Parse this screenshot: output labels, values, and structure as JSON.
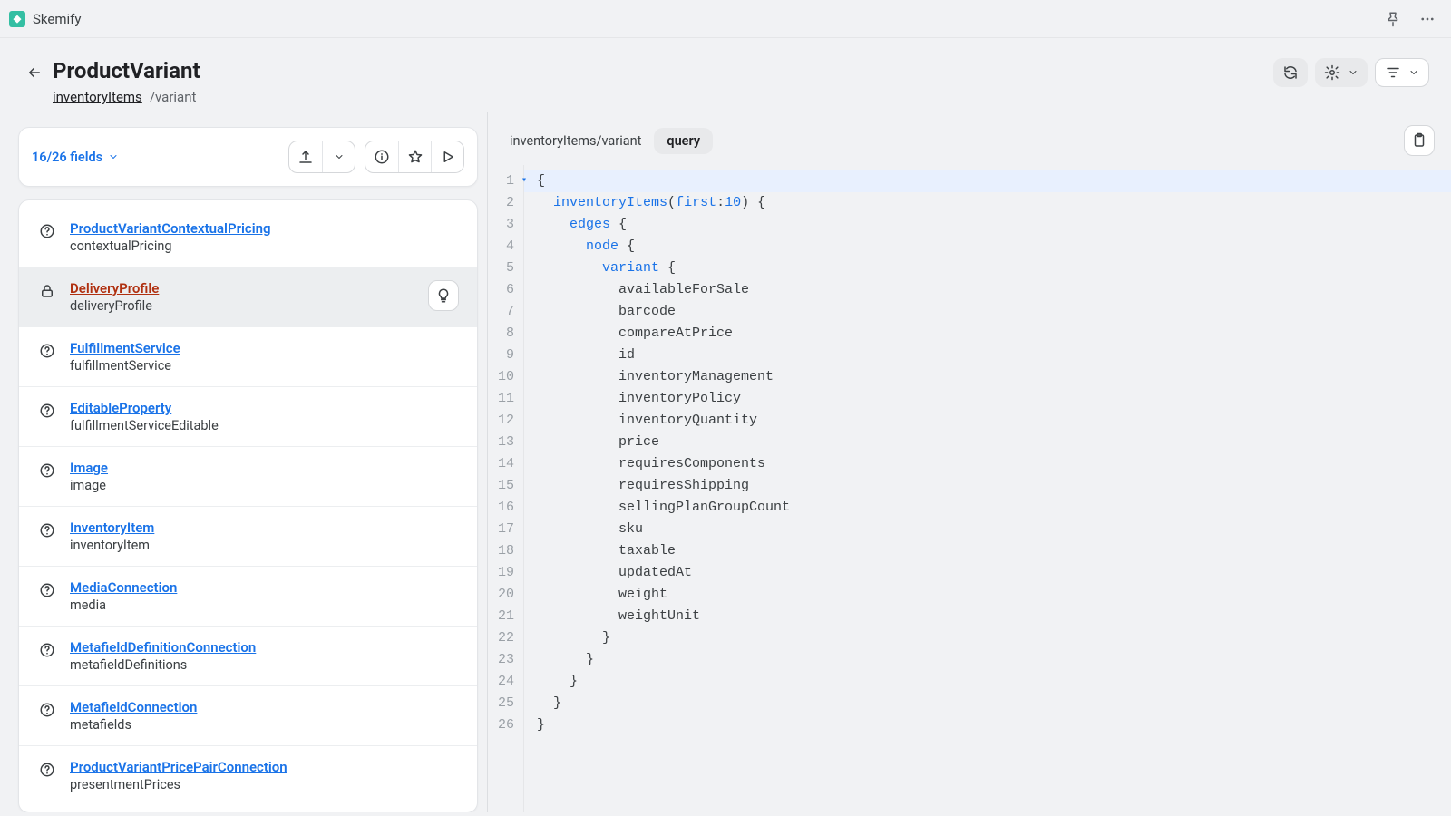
{
  "app": {
    "name": "Skemify"
  },
  "header": {
    "title": "ProductVariant",
    "breadcrumb_link": "inventoryItems",
    "breadcrumb_tail": "/variant"
  },
  "controls": {
    "counter": "16/26 fields"
  },
  "fields": [
    {
      "type": "ProductVariantContextualPricing",
      "name": "contextualPricing",
      "icon": "help",
      "selected": false
    },
    {
      "type": "DeliveryProfile",
      "name": "deliveryProfile",
      "icon": "lock",
      "selected": true
    },
    {
      "type": "FulfillmentService",
      "name": "fulfillmentService",
      "icon": "help",
      "selected": false
    },
    {
      "type": "EditableProperty",
      "name": "fulfillmentServiceEditable",
      "icon": "help",
      "selected": false
    },
    {
      "type": "Image",
      "name": "image",
      "icon": "help",
      "selected": false
    },
    {
      "type": "InventoryItem",
      "name": "inventoryItem",
      "icon": "help",
      "selected": false
    },
    {
      "type": "MediaConnection",
      "name": "media",
      "icon": "help",
      "selected": false
    },
    {
      "type": "MetafieldDefinitionConnection",
      "name": "metafieldDefinitions",
      "icon": "help",
      "selected": false
    },
    {
      "type": "MetafieldConnection",
      "name": "metafields",
      "icon": "help",
      "selected": false
    },
    {
      "type": "ProductVariantPricePairConnection",
      "name": "presentmentPrices",
      "icon": "help",
      "selected": false
    }
  ],
  "code": {
    "path": "inventoryItems/variant",
    "tab": "query",
    "lines": [
      {
        "n": 1,
        "fold": true,
        "tokens": [
          [
            "brace",
            "{"
          ]
        ]
      },
      {
        "n": 2,
        "tokens": [
          [
            "text",
            "  "
          ],
          [
            "name",
            "inventoryItems"
          ],
          [
            "text",
            "("
          ],
          [
            "name",
            "first"
          ],
          [
            "text",
            ":"
          ],
          [
            "num",
            "10"
          ],
          [
            "text",
            ") "
          ],
          [
            "brace",
            "{"
          ]
        ]
      },
      {
        "n": 3,
        "tokens": [
          [
            "text",
            "    "
          ],
          [
            "name",
            "edges"
          ],
          [
            "text",
            " "
          ],
          [
            "brace",
            "{"
          ]
        ]
      },
      {
        "n": 4,
        "tokens": [
          [
            "text",
            "      "
          ],
          [
            "name",
            "node"
          ],
          [
            "text",
            " "
          ],
          [
            "brace",
            "{"
          ]
        ]
      },
      {
        "n": 5,
        "tokens": [
          [
            "text",
            "        "
          ],
          [
            "name",
            "variant"
          ],
          [
            "text",
            " "
          ],
          [
            "brace",
            "{"
          ]
        ]
      },
      {
        "n": 6,
        "tokens": [
          [
            "text",
            "          "
          ],
          [
            "field",
            "availableForSale"
          ]
        ]
      },
      {
        "n": 7,
        "tokens": [
          [
            "text",
            "          "
          ],
          [
            "field",
            "barcode"
          ]
        ]
      },
      {
        "n": 8,
        "tokens": [
          [
            "text",
            "          "
          ],
          [
            "field",
            "compareAtPrice"
          ]
        ]
      },
      {
        "n": 9,
        "tokens": [
          [
            "text",
            "          "
          ],
          [
            "field",
            "id"
          ]
        ]
      },
      {
        "n": 10,
        "tokens": [
          [
            "text",
            "          "
          ],
          [
            "field",
            "inventoryManagement"
          ]
        ]
      },
      {
        "n": 11,
        "tokens": [
          [
            "text",
            "          "
          ],
          [
            "field",
            "inventoryPolicy"
          ]
        ]
      },
      {
        "n": 12,
        "tokens": [
          [
            "text",
            "          "
          ],
          [
            "field",
            "inventoryQuantity"
          ]
        ]
      },
      {
        "n": 13,
        "tokens": [
          [
            "text",
            "          "
          ],
          [
            "field",
            "price"
          ]
        ]
      },
      {
        "n": 14,
        "tokens": [
          [
            "text",
            "          "
          ],
          [
            "field",
            "requiresComponents"
          ]
        ]
      },
      {
        "n": 15,
        "tokens": [
          [
            "text",
            "          "
          ],
          [
            "field",
            "requiresShipping"
          ]
        ]
      },
      {
        "n": 16,
        "tokens": [
          [
            "text",
            "          "
          ],
          [
            "field",
            "sellingPlanGroupCount"
          ]
        ]
      },
      {
        "n": 17,
        "tokens": [
          [
            "text",
            "          "
          ],
          [
            "field",
            "sku"
          ]
        ]
      },
      {
        "n": 18,
        "tokens": [
          [
            "text",
            "          "
          ],
          [
            "field",
            "taxable"
          ]
        ]
      },
      {
        "n": 19,
        "tokens": [
          [
            "text",
            "          "
          ],
          [
            "field",
            "updatedAt"
          ]
        ]
      },
      {
        "n": 20,
        "tokens": [
          [
            "text",
            "          "
          ],
          [
            "field",
            "weight"
          ]
        ]
      },
      {
        "n": 21,
        "tokens": [
          [
            "text",
            "          "
          ],
          [
            "field",
            "weightUnit"
          ]
        ]
      },
      {
        "n": 22,
        "tokens": [
          [
            "text",
            "        "
          ],
          [
            "brace",
            "}"
          ]
        ]
      },
      {
        "n": 23,
        "tokens": [
          [
            "text",
            "      "
          ],
          [
            "brace",
            "}"
          ]
        ]
      },
      {
        "n": 24,
        "tokens": [
          [
            "text",
            "    "
          ],
          [
            "brace",
            "}"
          ]
        ]
      },
      {
        "n": 25,
        "tokens": [
          [
            "text",
            "  "
          ],
          [
            "brace",
            "}"
          ]
        ]
      },
      {
        "n": 26,
        "tokens": [
          [
            "brace",
            "}"
          ]
        ]
      }
    ]
  }
}
